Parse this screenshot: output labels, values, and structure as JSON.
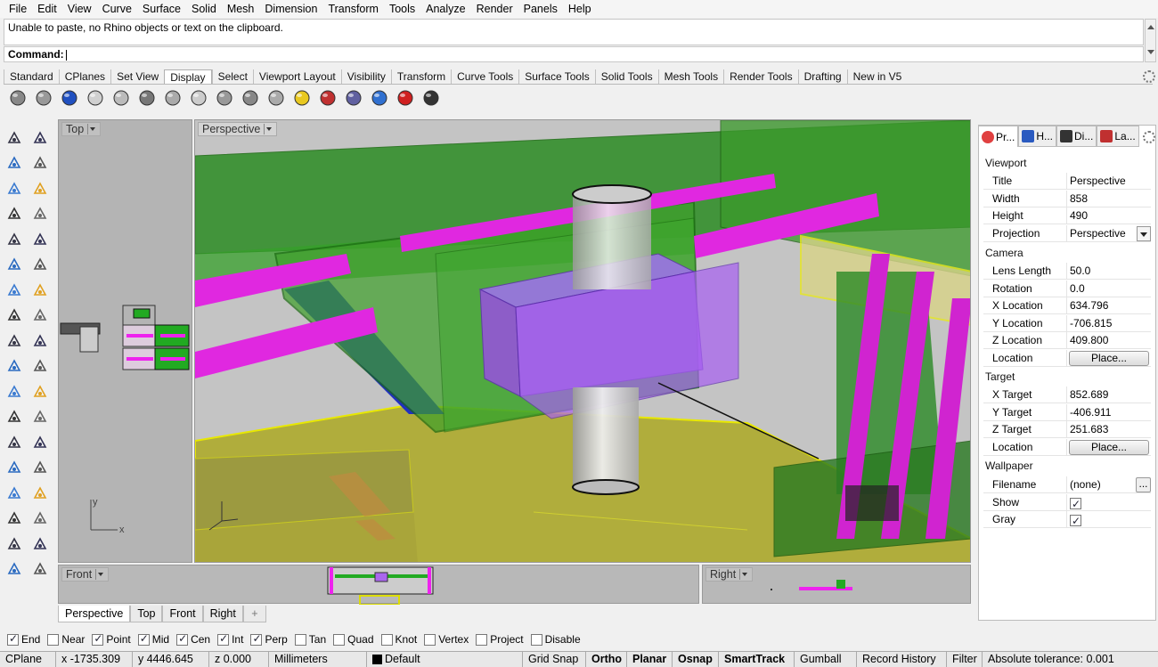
{
  "menu": [
    "File",
    "Edit",
    "View",
    "Curve",
    "Surface",
    "Solid",
    "Mesh",
    "Dimension",
    "Transform",
    "Tools",
    "Analyze",
    "Render",
    "Panels",
    "Help"
  ],
  "command": {
    "history": "Unable to paste, no Rhino objects or text on the clipboard.",
    "prompt": "Command:"
  },
  "tabs": [
    "Standard",
    "CPlanes",
    "Set View",
    "Display",
    "Select",
    "Viewport Layout",
    "Visibility",
    "Transform",
    "Curve Tools",
    "Surface Tools",
    "Solid Tools",
    "Mesh Tools",
    "Render Tools",
    "Drafting",
    "New in V5"
  ],
  "active_tab": "Display",
  "toolbar_icons": [
    "wireframe-globe-icon",
    "ghosted-sphere-icon",
    "shaded-sphere-icon",
    "rendered-sphere-icon",
    "wire-sphere-icon",
    "xray-icon",
    "technical-icon",
    "artistic-icon",
    "pen-icon",
    "grid-sphere-icon",
    "gray-sphere-icon",
    "light-sphere-icon",
    "zebra-target-icon",
    "environment-map-icon",
    "curvature-icon",
    "draft-angle-icon",
    "monitor-icon"
  ],
  "left_tools": [
    "select-arrow-icon",
    "point-icon",
    "polyline-icon",
    "control-point-curve-icon",
    "circle-icon",
    "ellipse-icon",
    "arc-icon",
    "rectangle-icon",
    "polygon-icon",
    "curve-tools-icon",
    "surface-corner-icon",
    "extrude-surface-icon",
    "box-icon",
    "sphere-union-icon",
    "cylinder-icon",
    "mesh-icon",
    "transform-gear-icon",
    "explode-icon",
    "boolean-icon",
    "trim-icon",
    "surface-union-icon",
    "shade-icon",
    "bend-icon",
    "curve-sweep-icon",
    "text-icon",
    "dimension-icon",
    "array-icon",
    "gumball-icon",
    "box-edit-icon",
    "render-icon",
    "grid-array-icon",
    "move-vertical-icon",
    "panel-icon",
    "check-icon",
    "solid-edit-icon",
    "paint-icon"
  ],
  "viewports": {
    "top": "Top",
    "perspective": "Perspective",
    "front": "Front",
    "right": "Right"
  },
  "viewport_tabs": [
    "Perspective",
    "Top",
    "Front",
    "Right"
  ],
  "active_viewport_tab": "Perspective",
  "panel": {
    "tabs": [
      "Pr...",
      "H...",
      "Di...",
      "La..."
    ],
    "sections": {
      "viewport": "Viewport",
      "camera": "Camera",
      "target": "Target",
      "wallpaper": "Wallpaper"
    },
    "viewport_rows": [
      {
        "k": "Title",
        "v": "Perspective"
      },
      {
        "k": "Width",
        "v": "858"
      },
      {
        "k": "Height",
        "v": "490"
      },
      {
        "k": "Projection",
        "v": "Perspective"
      }
    ],
    "camera_rows": [
      {
        "k": "Lens Length",
        "v": "50.0"
      },
      {
        "k": "Rotation",
        "v": "0.0"
      },
      {
        "k": "X Location",
        "v": "634.796"
      },
      {
        "k": "Y Location",
        "v": "-706.815"
      },
      {
        "k": "Z Location",
        "v": "409.800"
      },
      {
        "k": "Location",
        "v": "Place..."
      }
    ],
    "target_rows": [
      {
        "k": "X Target",
        "v": "852.689"
      },
      {
        "k": "Y Target",
        "v": "-406.911"
      },
      {
        "k": "Z Target",
        "v": "251.683"
      },
      {
        "k": "Location",
        "v": "Place..."
      }
    ],
    "wallpaper_rows": [
      {
        "k": "Filename",
        "v": "(none)"
      },
      {
        "k": "Show",
        "v": "checked"
      },
      {
        "k": "Gray",
        "v": "checked"
      }
    ]
  },
  "osnaps": [
    {
      "label": "End",
      "checked": true
    },
    {
      "label": "Near",
      "checked": false
    },
    {
      "label": "Point",
      "checked": true
    },
    {
      "label": "Mid",
      "checked": true
    },
    {
      "label": "Cen",
      "checked": true
    },
    {
      "label": "Int",
      "checked": true
    },
    {
      "label": "Perp",
      "checked": true
    },
    {
      "label": "Tan",
      "checked": false
    },
    {
      "label": "Quad",
      "checked": false
    },
    {
      "label": "Knot",
      "checked": false
    },
    {
      "label": "Vertex",
      "checked": false
    },
    {
      "label": "Project",
      "checked": false
    },
    {
      "label": "Disable",
      "checked": false
    }
  ],
  "status": {
    "cplane": "CPlane",
    "x": "x -1735.309",
    "y": "y 4446.645",
    "z": "z 0.000",
    "units": "Millimeters",
    "layer": "Default",
    "grid_snap": "Grid Snap",
    "ortho": "Ortho",
    "planar": "Planar",
    "osnap": "Osnap",
    "smarttrack": "SmartTrack",
    "gumball": "Gumball",
    "record_history": "Record History",
    "filter": "Filter",
    "tolerance": "Absolute tolerance: 0.001"
  },
  "colors": {
    "green_block": "#2e9a1e",
    "magenta_pipe": "#e020e0",
    "purple_block": "#9a50e8",
    "yellow_base": "#b8b420",
    "viewport_bg": "#c4c4c4"
  }
}
